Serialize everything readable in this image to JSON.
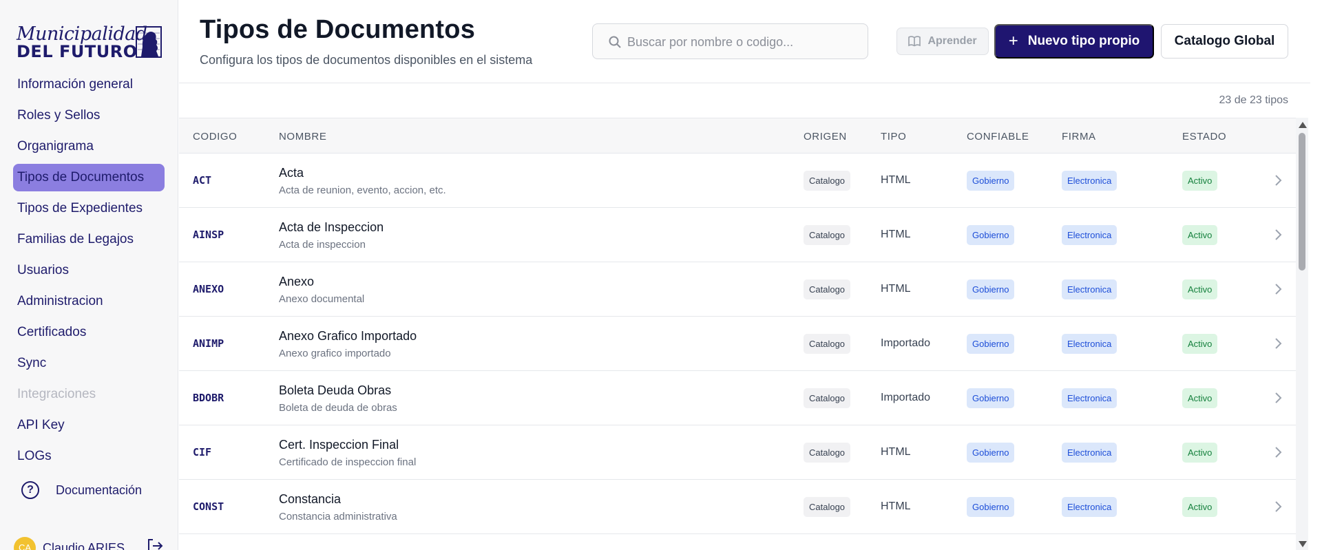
{
  "brand": {
    "line1": "Municipalidad",
    "line2": "DEL FUTURO",
    "color": "#1e1b6b"
  },
  "sidebar": {
    "items": [
      {
        "label": "Información general",
        "active": false
      },
      {
        "label": "Roles y Sellos",
        "active": false
      },
      {
        "label": "Organigrama",
        "active": false
      },
      {
        "label": "Tipos de Documentos",
        "active": true
      },
      {
        "label": "Tipos de Expedientes",
        "active": false
      },
      {
        "label": "Familias de Legajos",
        "active": false
      },
      {
        "label": "Usuarios",
        "active": false
      },
      {
        "label": "Administracion",
        "active": false
      },
      {
        "label": "Certificados",
        "active": false
      },
      {
        "label": "Sync",
        "active": false
      },
      {
        "label": "Integraciones",
        "active": false,
        "disabled": true
      },
      {
        "label": "API Key",
        "active": false
      },
      {
        "label": "LOGs",
        "active": false
      }
    ],
    "documentation": {
      "label": "Documentación",
      "icon": "help-circle-icon"
    },
    "user": {
      "initials": "CA",
      "name": "Claudio ARIES",
      "logout_icon": "logout-icon"
    },
    "active_color": "#8b7ee0"
  },
  "header": {
    "title": "Tipos de Documentos",
    "subtitle": "Configura los tipos de documentos disponibles en el sistema",
    "search": {
      "placeholder": "Buscar por nombre o codigo...",
      "value": "",
      "icon": "search-icon"
    },
    "learn_label": "Aprender",
    "new_label": "Nuevo tipo propio",
    "global_label": "Catalogo Global",
    "primary_color": "#1f1570"
  },
  "table": {
    "count": "23 de 23 tipos",
    "columns": {
      "codigo": "CODIGO",
      "nombre": "NOMBRE",
      "origen": "ORIGEN",
      "tipo": "TIPO",
      "confiable": "CONFIABLE",
      "firma": "FIRMA",
      "estado": "ESTADO"
    },
    "rows": [
      {
        "codigo": "ACT",
        "nombre": "Acta",
        "descripcion": "Acta de reunion, evento, accion, etc.",
        "origen": "Catalogo",
        "tipo": "HTML",
        "confiable": "Gobierno",
        "firma": "Electronica",
        "estado": "Activo"
      },
      {
        "codigo": "AINSP",
        "nombre": "Acta de Inspeccion",
        "descripcion": "Acta de inspeccion",
        "origen": "Catalogo",
        "tipo": "HTML",
        "confiable": "Gobierno",
        "firma": "Electronica",
        "estado": "Activo"
      },
      {
        "codigo": "ANEXO",
        "nombre": "Anexo",
        "descripcion": "Anexo documental",
        "origen": "Catalogo",
        "tipo": "HTML",
        "confiable": "Gobierno",
        "firma": "Electronica",
        "estado": "Activo"
      },
      {
        "codigo": "ANIMP",
        "nombre": "Anexo Grafico Importado",
        "descripcion": "Anexo grafico importado",
        "origen": "Catalogo",
        "tipo": "Importado",
        "confiable": "Gobierno",
        "firma": "Electronica",
        "estado": "Activo"
      },
      {
        "codigo": "BDOBR",
        "nombre": "Boleta Deuda Obras",
        "descripcion": "Boleta de deuda de obras",
        "origen": "Catalogo",
        "tipo": "Importado",
        "confiable": "Gobierno",
        "firma": "Electronica",
        "estado": "Activo"
      },
      {
        "codigo": "CIF",
        "nombre": "Cert. Inspeccion Final",
        "descripcion": "Certificado de inspeccion final",
        "origen": "Catalogo",
        "tipo": "HTML",
        "confiable": "Gobierno",
        "firma": "Electronica",
        "estado": "Activo"
      },
      {
        "codigo": "CONST",
        "nombre": "Constancia",
        "descripcion": "Constancia administrativa",
        "origen": "Catalogo",
        "tipo": "HTML",
        "confiable": "Gobierno",
        "firma": "Electronica",
        "estado": "Activo"
      }
    ],
    "row_icon": "chevron-right-icon",
    "tag_colors": {
      "confiable": "#1d4ed8",
      "firma": "#1d4ed8",
      "estado": "#15803d"
    }
  }
}
